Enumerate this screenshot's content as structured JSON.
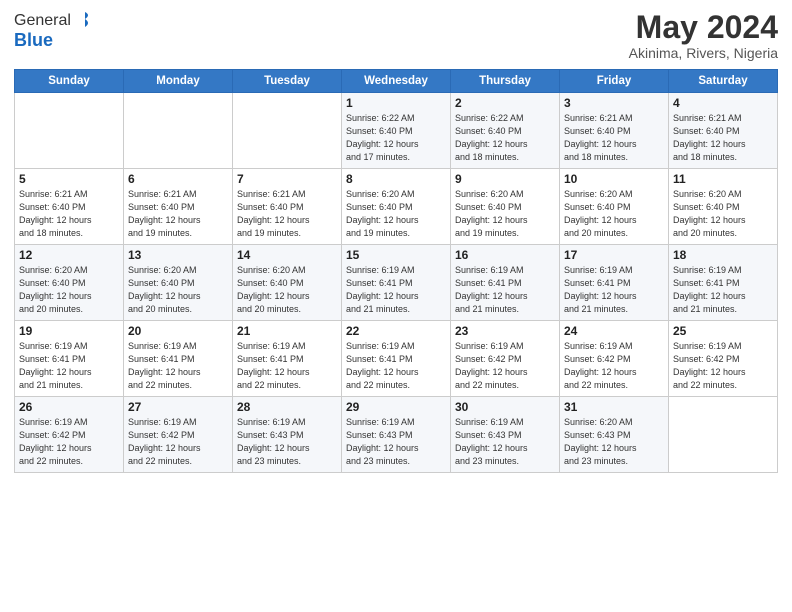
{
  "header": {
    "logo_line1": "General",
    "logo_line2": "Blue",
    "month": "May 2024",
    "location": "Akinima, Rivers, Nigeria"
  },
  "weekdays": [
    "Sunday",
    "Monday",
    "Tuesday",
    "Wednesday",
    "Thursday",
    "Friday",
    "Saturday"
  ],
  "weeks": [
    [
      {
        "day": "",
        "info": ""
      },
      {
        "day": "",
        "info": ""
      },
      {
        "day": "",
        "info": ""
      },
      {
        "day": "1",
        "info": "Sunrise: 6:22 AM\nSunset: 6:40 PM\nDaylight: 12 hours\nand 17 minutes."
      },
      {
        "day": "2",
        "info": "Sunrise: 6:22 AM\nSunset: 6:40 PM\nDaylight: 12 hours\nand 18 minutes."
      },
      {
        "day": "3",
        "info": "Sunrise: 6:21 AM\nSunset: 6:40 PM\nDaylight: 12 hours\nand 18 minutes."
      },
      {
        "day": "4",
        "info": "Sunrise: 6:21 AM\nSunset: 6:40 PM\nDaylight: 12 hours\nand 18 minutes."
      }
    ],
    [
      {
        "day": "5",
        "info": "Sunrise: 6:21 AM\nSunset: 6:40 PM\nDaylight: 12 hours\nand 18 minutes."
      },
      {
        "day": "6",
        "info": "Sunrise: 6:21 AM\nSunset: 6:40 PM\nDaylight: 12 hours\nand 19 minutes."
      },
      {
        "day": "7",
        "info": "Sunrise: 6:21 AM\nSunset: 6:40 PM\nDaylight: 12 hours\nand 19 minutes."
      },
      {
        "day": "8",
        "info": "Sunrise: 6:20 AM\nSunset: 6:40 PM\nDaylight: 12 hours\nand 19 minutes."
      },
      {
        "day": "9",
        "info": "Sunrise: 6:20 AM\nSunset: 6:40 PM\nDaylight: 12 hours\nand 19 minutes."
      },
      {
        "day": "10",
        "info": "Sunrise: 6:20 AM\nSunset: 6:40 PM\nDaylight: 12 hours\nand 20 minutes."
      },
      {
        "day": "11",
        "info": "Sunrise: 6:20 AM\nSunset: 6:40 PM\nDaylight: 12 hours\nand 20 minutes."
      }
    ],
    [
      {
        "day": "12",
        "info": "Sunrise: 6:20 AM\nSunset: 6:40 PM\nDaylight: 12 hours\nand 20 minutes."
      },
      {
        "day": "13",
        "info": "Sunrise: 6:20 AM\nSunset: 6:40 PM\nDaylight: 12 hours\nand 20 minutes."
      },
      {
        "day": "14",
        "info": "Sunrise: 6:20 AM\nSunset: 6:40 PM\nDaylight: 12 hours\nand 20 minutes."
      },
      {
        "day": "15",
        "info": "Sunrise: 6:19 AM\nSunset: 6:41 PM\nDaylight: 12 hours\nand 21 minutes."
      },
      {
        "day": "16",
        "info": "Sunrise: 6:19 AM\nSunset: 6:41 PM\nDaylight: 12 hours\nand 21 minutes."
      },
      {
        "day": "17",
        "info": "Sunrise: 6:19 AM\nSunset: 6:41 PM\nDaylight: 12 hours\nand 21 minutes."
      },
      {
        "day": "18",
        "info": "Sunrise: 6:19 AM\nSunset: 6:41 PM\nDaylight: 12 hours\nand 21 minutes."
      }
    ],
    [
      {
        "day": "19",
        "info": "Sunrise: 6:19 AM\nSunset: 6:41 PM\nDaylight: 12 hours\nand 21 minutes."
      },
      {
        "day": "20",
        "info": "Sunrise: 6:19 AM\nSunset: 6:41 PM\nDaylight: 12 hours\nand 22 minutes."
      },
      {
        "day": "21",
        "info": "Sunrise: 6:19 AM\nSunset: 6:41 PM\nDaylight: 12 hours\nand 22 minutes."
      },
      {
        "day": "22",
        "info": "Sunrise: 6:19 AM\nSunset: 6:41 PM\nDaylight: 12 hours\nand 22 minutes."
      },
      {
        "day": "23",
        "info": "Sunrise: 6:19 AM\nSunset: 6:42 PM\nDaylight: 12 hours\nand 22 minutes."
      },
      {
        "day": "24",
        "info": "Sunrise: 6:19 AM\nSunset: 6:42 PM\nDaylight: 12 hours\nand 22 minutes."
      },
      {
        "day": "25",
        "info": "Sunrise: 6:19 AM\nSunset: 6:42 PM\nDaylight: 12 hours\nand 22 minutes."
      }
    ],
    [
      {
        "day": "26",
        "info": "Sunrise: 6:19 AM\nSunset: 6:42 PM\nDaylight: 12 hours\nand 22 minutes."
      },
      {
        "day": "27",
        "info": "Sunrise: 6:19 AM\nSunset: 6:42 PM\nDaylight: 12 hours\nand 22 minutes."
      },
      {
        "day": "28",
        "info": "Sunrise: 6:19 AM\nSunset: 6:43 PM\nDaylight: 12 hours\nand 23 minutes."
      },
      {
        "day": "29",
        "info": "Sunrise: 6:19 AM\nSunset: 6:43 PM\nDaylight: 12 hours\nand 23 minutes."
      },
      {
        "day": "30",
        "info": "Sunrise: 6:19 AM\nSunset: 6:43 PM\nDaylight: 12 hours\nand 23 minutes."
      },
      {
        "day": "31",
        "info": "Sunrise: 6:20 AM\nSunset: 6:43 PM\nDaylight: 12 hours\nand 23 minutes."
      },
      {
        "day": "",
        "info": ""
      }
    ]
  ]
}
